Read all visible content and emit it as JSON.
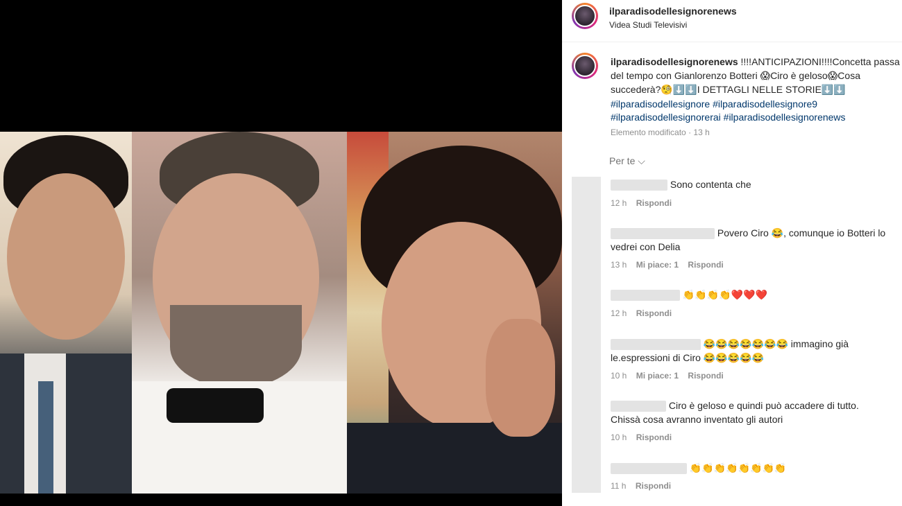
{
  "post": {
    "username": "ilparadisodellesignorenews",
    "location": "Videa Studi Televisivi"
  },
  "caption": {
    "username": "ilparadisodellesignorenews",
    "text_1": "!!!!ANTICIPAZIONI!!!!Concetta passa",
    "text_2": "del tempo con Gianlorenzo Botteri",
    "emoji_shock": "😱",
    "text_3": "Ciro è geloso",
    "text_4": "Cosa",
    "text_5": "succederà?",
    "emoji_think": "🧐",
    "emoji_down": "⬇️⬇️",
    "text_6": "I DETTAGLI NELLE STORIE",
    "hashtags_line1": "#ilparadisodellesignore #ilparadisodellesignore9",
    "hashtags_line2": "#ilparadisodellesignorerai #ilparadisodellesignorenews",
    "edited": "Elemento modificato",
    "time": "13 h"
  },
  "filter": {
    "label": "Per te"
  },
  "comments": [
    {
      "text": "Sono contenta che",
      "time": "12 h",
      "likes": "",
      "reply": "Rispondi"
    },
    {
      "text": "Povero Ciro 😂, comunque io Botteri lo",
      "text2": "vedrei con Delia",
      "time": "13 h",
      "likes": "Mi piace: 1",
      "reply": "Rispondi"
    },
    {
      "text": "👏👏👏👏❤️❤️❤️",
      "time": "12 h",
      "likes": "",
      "reply": "Rispondi"
    },
    {
      "text": "😂😂😂😂😂😂😂 immagino già",
      "text2": "le.espressioni di Ciro 😂😂😂😂😂",
      "time": "10 h",
      "likes": "Mi piace: 1",
      "reply": "Rispondi"
    },
    {
      "text": "Ciro è geloso e quindi può accadere di tutto.",
      "text2": "Chissà cosa avranno inventato gli autori",
      "time": "10 h",
      "likes": "",
      "reply": "Rispondi"
    },
    {
      "text": "👏👏👏👏👏👏👏👏",
      "time": "11 h",
      "likes": "",
      "reply": "Rispondi"
    }
  ]
}
